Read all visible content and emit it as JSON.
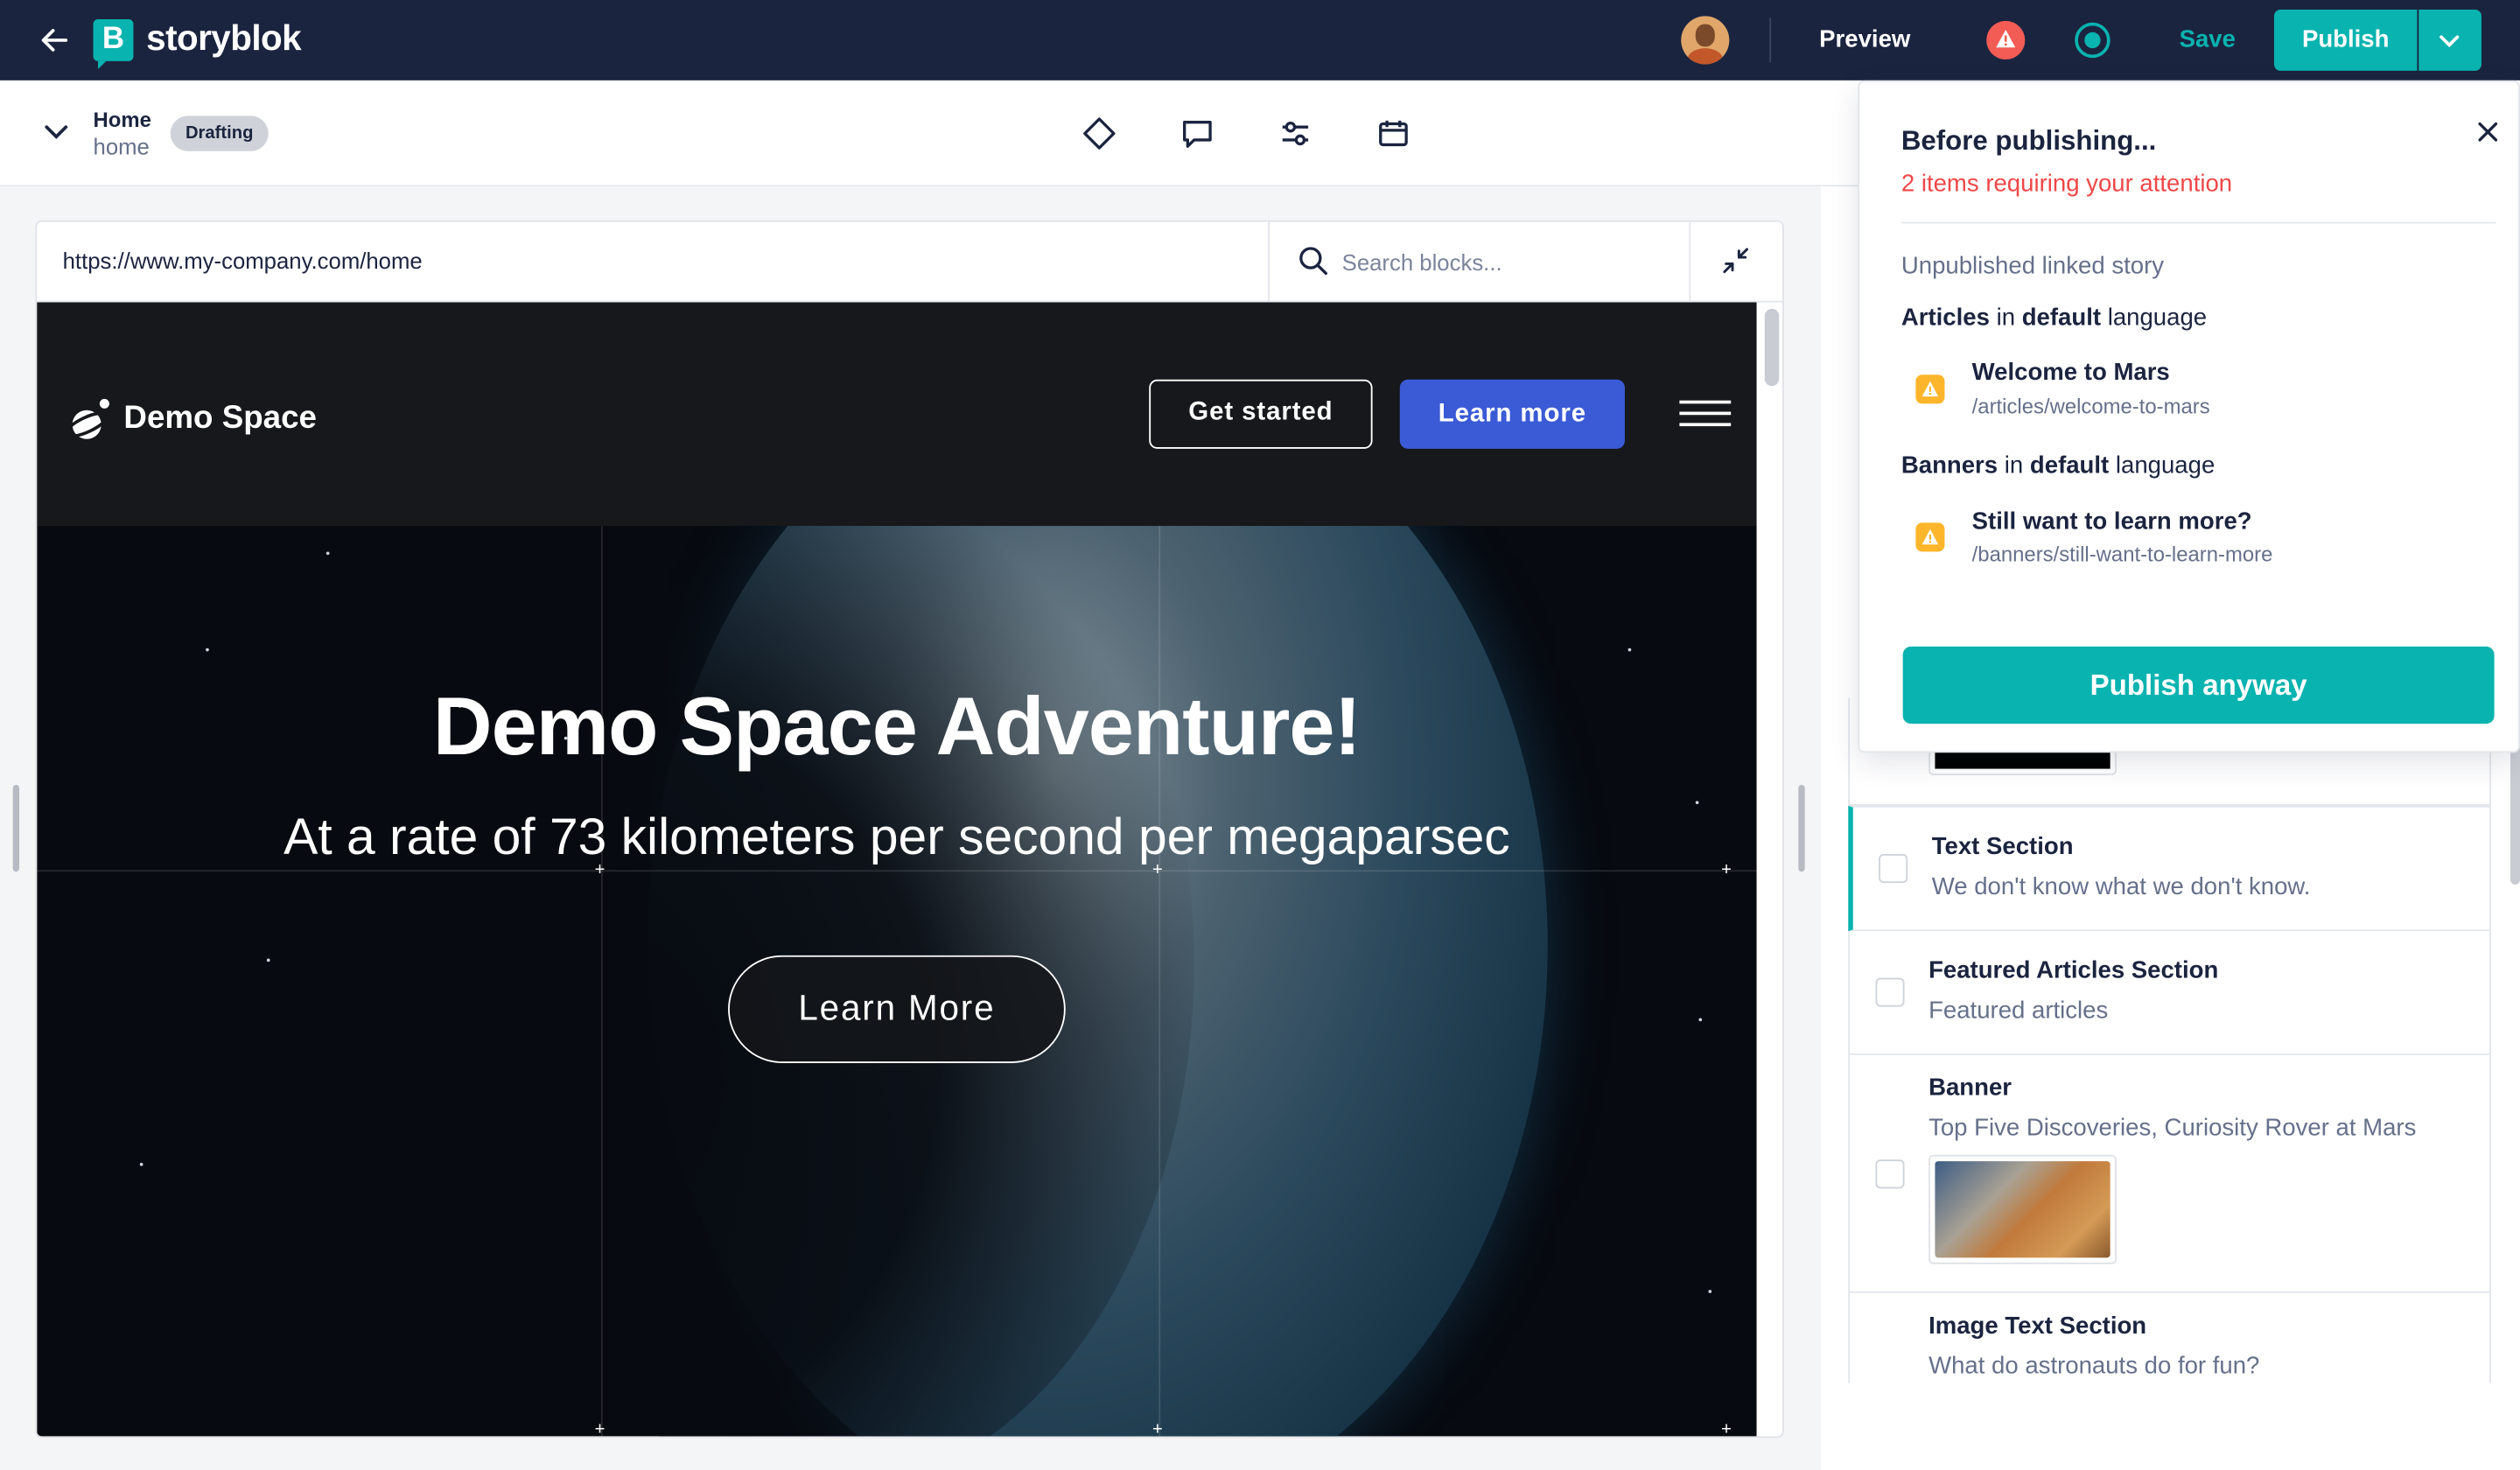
{
  "topbar": {
    "brand": "storyblok",
    "preview_label": "Preview",
    "save_label": "Save",
    "publish_label": "Publish",
    "colors": {
      "bar": "#1b243f",
      "accent": "#09b3af",
      "warning": "#f25c54"
    }
  },
  "story": {
    "title": "Home",
    "slug": "home",
    "status_badge": "Drafting"
  },
  "toolbar": {
    "icons": [
      "diamond-icon",
      "comment-icon",
      "sliders-icon",
      "calendar-icon"
    ]
  },
  "preview": {
    "url": "https://www.my-company.com/home",
    "search_placeholder": "Search blocks..."
  },
  "site": {
    "brand": "Demo Space",
    "nav_buttons": [
      "Get started",
      "Learn more"
    ],
    "hero_title": "Demo Space Adventure!",
    "hero_subtitle": "At a rate of 73 kilometers per second per megaparsec",
    "hero_button": "Learn More"
  },
  "right_panel": {
    "blocks": [
      {
        "title": "Text Section",
        "description": "We don't know what we don't know."
      },
      {
        "title": "Featured Articles Section",
        "description": "Featured articles"
      },
      {
        "title": "Banner",
        "description": "Top Five Discoveries, Curiosity Rover at Mars"
      },
      {
        "title": "Image Text Section",
        "description": "What do astronauts do for fun?"
      }
    ]
  },
  "popup": {
    "title": "Before publishing...",
    "alert": "2 items requiring your attention",
    "section": "Unpublished linked story",
    "groups": [
      {
        "name": "Articles",
        "in": "in",
        "lang": "default",
        "suffix": "language",
        "item": {
          "name": "Welcome to Mars",
          "path": "/articles/welcome-to-mars"
        }
      },
      {
        "name": "Banners",
        "in": "in",
        "lang": "default",
        "suffix": "language",
        "item": {
          "name": "Still want to learn more?",
          "path": "/banners/still-want-to-learn-more"
        }
      }
    ],
    "button": "Publish anyway"
  }
}
